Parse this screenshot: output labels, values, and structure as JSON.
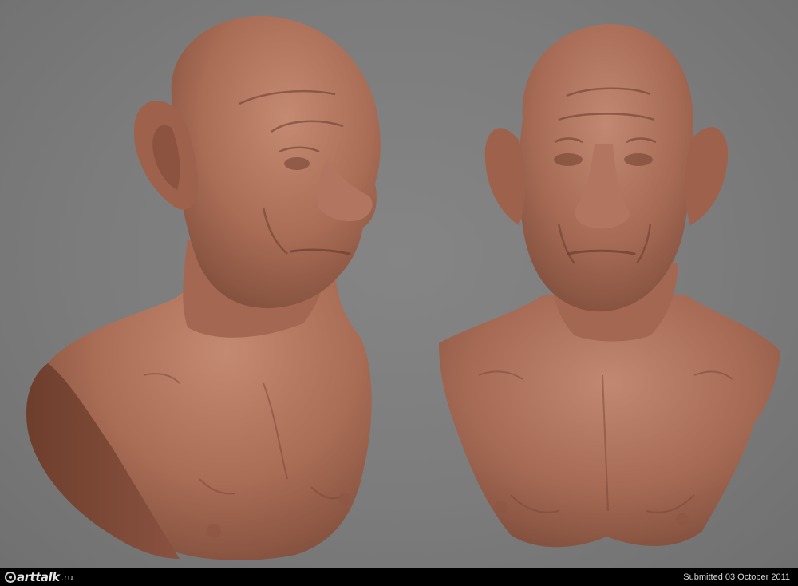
{
  "watermark": {
    "logo_text": "arttalk",
    "logo_suffix": ".ru"
  },
  "caption": {
    "submitted": "Submitted 03 October 2011"
  },
  "colors": {
    "background": "#7a7a7a",
    "clay": "#a86c55",
    "footer": "#000000"
  }
}
